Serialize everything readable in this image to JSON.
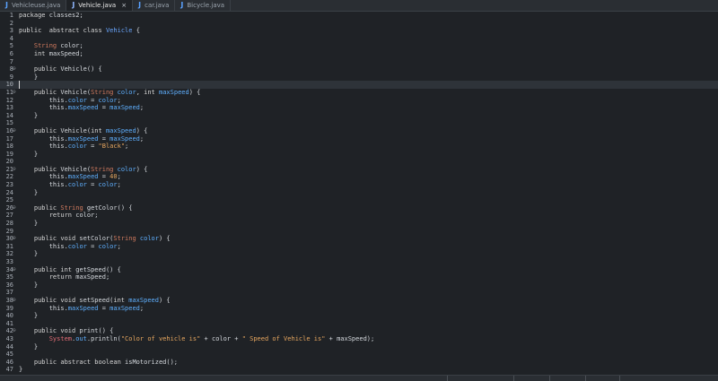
{
  "tabs": [
    {
      "label": "Vehicleuse.java",
      "active": false,
      "icon": "java-file-icon"
    },
    {
      "label": "Vehicle.java",
      "active": true,
      "icon": "java-file-icon",
      "close": "×"
    },
    {
      "label": "car.java",
      "active": false,
      "icon": "java-file-icon"
    },
    {
      "label": "Bicycle.java",
      "active": false,
      "icon": "java-file-icon"
    }
  ],
  "editor": {
    "current_line": 10,
    "lines": [
      {
        "n": "1",
        "fold": "",
        "tokens": [
          [
            "kw",
            "package"
          ],
          [
            "t",
            " classes2;"
          ]
        ]
      },
      {
        "n": "2",
        "fold": "",
        "tokens": []
      },
      {
        "n": "3",
        "fold": "",
        "tokens": [
          [
            "kw",
            "public"
          ],
          [
            "t",
            "  "
          ],
          [
            "kw",
            "abstract class"
          ],
          [
            "t",
            " "
          ],
          [
            "cls",
            "Vehicle"
          ],
          [
            "t",
            " {"
          ]
        ]
      },
      {
        "n": "4",
        "fold": "",
        "tokens": []
      },
      {
        "n": "5",
        "fold": "",
        "tokens": [
          [
            "t",
            "    "
          ],
          [
            "ty",
            "String"
          ],
          [
            "t",
            " color;"
          ]
        ]
      },
      {
        "n": "6",
        "fold": "",
        "tokens": [
          [
            "t",
            "    "
          ],
          [
            "kw",
            "int"
          ],
          [
            "t",
            " maxSpeed;"
          ]
        ]
      },
      {
        "n": "7",
        "fold": "",
        "tokens": []
      },
      {
        "n": "8",
        "fold": "⊖",
        "tokens": [
          [
            "t",
            "    "
          ],
          [
            "kw",
            "public"
          ],
          [
            "t",
            " Vehicle() {"
          ]
        ]
      },
      {
        "n": "9",
        "fold": "",
        "tokens": [
          [
            "t",
            "    }"
          ]
        ]
      },
      {
        "n": "10",
        "fold": "",
        "tokens": []
      },
      {
        "n": "11",
        "fold": "⊖",
        "tokens": [
          [
            "t",
            "    "
          ],
          [
            "kw",
            "public"
          ],
          [
            "t",
            " Vehicle("
          ],
          [
            "ty",
            "String"
          ],
          [
            "t",
            " "
          ],
          [
            "var",
            "color"
          ],
          [
            "t",
            ", "
          ],
          [
            "kw",
            "int"
          ],
          [
            "t",
            " "
          ],
          [
            "var",
            "maxSpeed"
          ],
          [
            "t",
            ") {"
          ]
        ]
      },
      {
        "n": "12",
        "fold": "",
        "tokens": [
          [
            "t",
            "        this."
          ],
          [
            "var",
            "color"
          ],
          [
            "t",
            " = "
          ],
          [
            "var",
            "color"
          ],
          [
            "t",
            ";"
          ]
        ]
      },
      {
        "n": "13",
        "fold": "",
        "tokens": [
          [
            "t",
            "        this."
          ],
          [
            "var",
            "maxSpeed"
          ],
          [
            "t",
            " = "
          ],
          [
            "var",
            "maxSpeed"
          ],
          [
            "t",
            ";"
          ]
        ]
      },
      {
        "n": "14",
        "fold": "",
        "tokens": [
          [
            "t",
            "    }"
          ]
        ]
      },
      {
        "n": "15",
        "fold": "",
        "tokens": []
      },
      {
        "n": "16",
        "fold": "⊖",
        "tokens": [
          [
            "t",
            "    "
          ],
          [
            "kw",
            "public"
          ],
          [
            "t",
            " Vehicle("
          ],
          [
            "kw",
            "int"
          ],
          [
            "t",
            " "
          ],
          [
            "var",
            "maxSpeed"
          ],
          [
            "t",
            ") {"
          ]
        ]
      },
      {
        "n": "17",
        "fold": "",
        "tokens": [
          [
            "t",
            "        this."
          ],
          [
            "var",
            "maxSpeed"
          ],
          [
            "t",
            " = "
          ],
          [
            "var",
            "maxSpeed"
          ],
          [
            "t",
            ";"
          ]
        ]
      },
      {
        "n": "18",
        "fold": "",
        "tokens": [
          [
            "t",
            "        this."
          ],
          [
            "var",
            "color"
          ],
          [
            "t",
            " = "
          ],
          [
            "str",
            "\"Black\""
          ],
          [
            "t",
            ";"
          ]
        ]
      },
      {
        "n": "19",
        "fold": "",
        "tokens": [
          [
            "t",
            "    }"
          ]
        ]
      },
      {
        "n": "20",
        "fold": "",
        "tokens": []
      },
      {
        "n": "21",
        "fold": "⊖",
        "tokens": [
          [
            "t",
            "    "
          ],
          [
            "kw",
            "public"
          ],
          [
            "t",
            " Vehicle("
          ],
          [
            "ty",
            "String"
          ],
          [
            "t",
            " "
          ],
          [
            "var",
            "color"
          ],
          [
            "t",
            ") {"
          ]
        ]
      },
      {
        "n": "22",
        "fold": "",
        "tokens": [
          [
            "t",
            "        this."
          ],
          [
            "var",
            "maxSpeed"
          ],
          [
            "t",
            " = "
          ],
          [
            "num",
            "40"
          ],
          [
            "t",
            ";"
          ]
        ]
      },
      {
        "n": "23",
        "fold": "",
        "tokens": [
          [
            "t",
            "        this."
          ],
          [
            "var",
            "color"
          ],
          [
            "t",
            " = "
          ],
          [
            "var",
            "color"
          ],
          [
            "t",
            ";"
          ]
        ]
      },
      {
        "n": "24",
        "fold": "",
        "tokens": [
          [
            "t",
            "    }"
          ]
        ]
      },
      {
        "n": "25",
        "fold": "",
        "tokens": []
      },
      {
        "n": "26",
        "fold": "⊖",
        "tokens": [
          [
            "t",
            "    "
          ],
          [
            "kw",
            "public"
          ],
          [
            "t",
            " "
          ],
          [
            "ty",
            "String"
          ],
          [
            "t",
            " getColor() {"
          ]
        ]
      },
      {
        "n": "27",
        "fold": "",
        "tokens": [
          [
            "t",
            "        "
          ],
          [
            "kw",
            "return"
          ],
          [
            "t",
            " color;"
          ]
        ]
      },
      {
        "n": "28",
        "fold": "",
        "tokens": [
          [
            "t",
            "    }"
          ]
        ]
      },
      {
        "n": "29",
        "fold": "",
        "tokens": []
      },
      {
        "n": "30",
        "fold": "⊖",
        "tokens": [
          [
            "t",
            "    "
          ],
          [
            "kw",
            "public void"
          ],
          [
            "t",
            " setColor("
          ],
          [
            "ty",
            "String"
          ],
          [
            "t",
            " "
          ],
          [
            "var",
            "color"
          ],
          [
            "t",
            ") {"
          ]
        ]
      },
      {
        "n": "31",
        "fold": "",
        "tokens": [
          [
            "t",
            "        this."
          ],
          [
            "var",
            "color"
          ],
          [
            "t",
            " = "
          ],
          [
            "var",
            "color"
          ],
          [
            "t",
            ";"
          ]
        ]
      },
      {
        "n": "32",
        "fold": "",
        "tokens": [
          [
            "t",
            "    }"
          ]
        ]
      },
      {
        "n": "33",
        "fold": "",
        "tokens": []
      },
      {
        "n": "34",
        "fold": "⊖",
        "tokens": [
          [
            "t",
            "    "
          ],
          [
            "kw",
            "public int"
          ],
          [
            "t",
            " getSpeed() {"
          ]
        ]
      },
      {
        "n": "35",
        "fold": "",
        "tokens": [
          [
            "t",
            "        "
          ],
          [
            "kw",
            "return"
          ],
          [
            "t",
            " maxSpeed;"
          ]
        ]
      },
      {
        "n": "36",
        "fold": "",
        "tokens": [
          [
            "t",
            "    }"
          ]
        ]
      },
      {
        "n": "37",
        "fold": "",
        "tokens": []
      },
      {
        "n": "38",
        "fold": "⊖",
        "tokens": [
          [
            "t",
            "    "
          ],
          [
            "kw",
            "public void"
          ],
          [
            "t",
            " setSpeed("
          ],
          [
            "kw",
            "int"
          ],
          [
            "t",
            " "
          ],
          [
            "var",
            "maxSpeed"
          ],
          [
            "t",
            ") {"
          ]
        ]
      },
      {
        "n": "39",
        "fold": "",
        "tokens": [
          [
            "t",
            "        this."
          ],
          [
            "var",
            "maxSpeed"
          ],
          [
            "t",
            " = "
          ],
          [
            "var",
            "maxSpeed"
          ],
          [
            "t",
            ";"
          ]
        ]
      },
      {
        "n": "40",
        "fold": "",
        "tokens": [
          [
            "t",
            "    }"
          ]
        ]
      },
      {
        "n": "41",
        "fold": "",
        "tokens": []
      },
      {
        "n": "42",
        "fold": "⊖",
        "tokens": [
          [
            "t",
            "    "
          ],
          [
            "kw",
            "public void"
          ],
          [
            "t",
            " print() {"
          ]
        ]
      },
      {
        "n": "43",
        "fold": "",
        "tokens": [
          [
            "t",
            "        "
          ],
          [
            "sys",
            "System"
          ],
          [
            "t",
            "."
          ],
          [
            "var",
            "out"
          ],
          [
            "t",
            ".println("
          ],
          [
            "str",
            "\"Color of vehicle is\""
          ],
          [
            "t",
            " + color + "
          ],
          [
            "str",
            "\" Speed of Vehicle is\""
          ],
          [
            "t",
            " + maxSpeed);"
          ]
        ]
      },
      {
        "n": "44",
        "fold": "",
        "tokens": [
          [
            "t",
            "    }"
          ]
        ]
      },
      {
        "n": "45",
        "fold": "",
        "tokens": []
      },
      {
        "n": "46",
        "fold": "",
        "tokens": [
          [
            "t",
            "    "
          ],
          [
            "kw",
            "public abstract boolean"
          ],
          [
            "t",
            " isMotorized();"
          ]
        ]
      },
      {
        "n": "47",
        "fold": "",
        "tokens": [
          [
            "t",
            "}"
          ]
        ]
      }
    ]
  },
  "colors": {
    "background": "#1f2226",
    "tabbar": "#2a2e33",
    "current_line": "#2e3339"
  }
}
